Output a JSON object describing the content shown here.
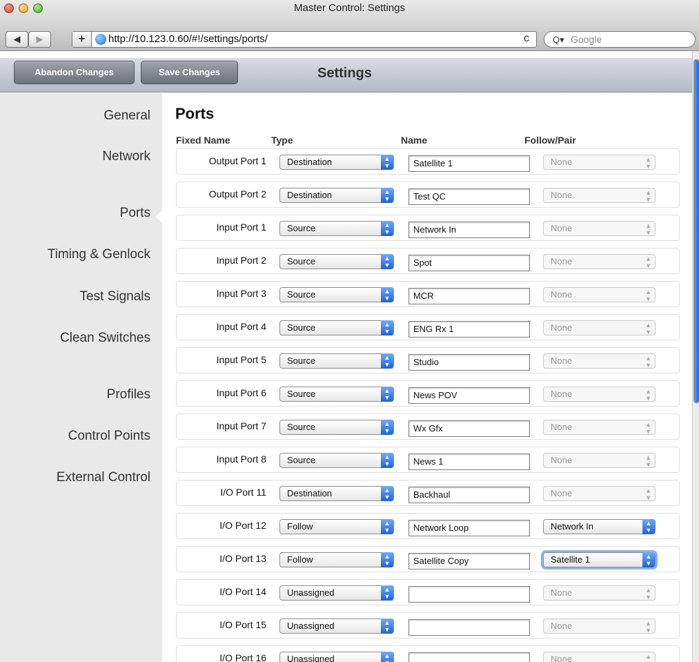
{
  "window": {
    "title": "Master Control: Settings"
  },
  "browser": {
    "url": "http://10.123.0.60/#!/settings/ports/",
    "search_placeholder": "Google",
    "back": "◀",
    "forward": "▶",
    "add": "+",
    "reload": "c"
  },
  "header": {
    "abandon_label": "Abandon Changes",
    "save_label": "Save Changes",
    "title": "Settings"
  },
  "sidebar": {
    "items": [
      {
        "label": "General"
      },
      {
        "label": "Network"
      },
      {
        "label": "Ports"
      },
      {
        "label": "Timing & Genlock"
      },
      {
        "label": "Test Signals"
      },
      {
        "label": "Clean Switches"
      },
      {
        "label": "Profiles"
      },
      {
        "label": "Control Points"
      },
      {
        "label": "External Control"
      }
    ],
    "active": "Ports"
  },
  "ports": {
    "heading": "Ports",
    "columns": {
      "fixed": "Fixed Name",
      "type": "Type",
      "name": "Name",
      "follow": "Follow/Pair"
    },
    "rows": [
      {
        "fixed": "Output Port 1",
        "type": "Destination",
        "name": "Satellite 1",
        "follow": "None",
        "follow_enabled": false
      },
      {
        "fixed": "Output Port 2",
        "type": "Destination",
        "name": "Test QC",
        "follow": "None",
        "follow_enabled": false
      },
      {
        "fixed": "Input Port 1",
        "type": "Source",
        "name": "Network In",
        "follow": "None",
        "follow_enabled": false
      },
      {
        "fixed": "Input Port 2",
        "type": "Source",
        "name": "Spot",
        "follow": "None",
        "follow_enabled": false
      },
      {
        "fixed": "Input Port 3",
        "type": "Source",
        "name": "MCR",
        "follow": "None",
        "follow_enabled": false
      },
      {
        "fixed": "Input Port 4",
        "type": "Source",
        "name": "ENG Rx 1",
        "follow": "None",
        "follow_enabled": false
      },
      {
        "fixed": "Input Port 5",
        "type": "Source",
        "name": "Studio",
        "follow": "None",
        "follow_enabled": false
      },
      {
        "fixed": "Input Port 6",
        "type": "Source",
        "name": "News POV",
        "follow": "None",
        "follow_enabled": false
      },
      {
        "fixed": "Input Port 7",
        "type": "Source",
        "name": "Wx Gfx",
        "follow": "None",
        "follow_enabled": false
      },
      {
        "fixed": "Input Port 8",
        "type": "Source",
        "name": "News 1",
        "follow": "None",
        "follow_enabled": false
      },
      {
        "fixed": "I/O Port 11",
        "type": "Destination",
        "name": "Backhaul",
        "follow": "None",
        "follow_enabled": false
      },
      {
        "fixed": "I/O Port 12",
        "type": "Follow",
        "name": "Network Loop",
        "follow": "Network In",
        "follow_enabled": true
      },
      {
        "fixed": "I/O Port 13",
        "type": "Follow",
        "name": "Satellite Copy",
        "follow": "Satellite 1",
        "follow_enabled": true,
        "focused": true
      },
      {
        "fixed": "I/O Port 14",
        "type": "Unassigned",
        "name": "",
        "follow": "None",
        "follow_enabled": false
      },
      {
        "fixed": "I/O Port 15",
        "type": "Unassigned",
        "name": "",
        "follow": "None",
        "follow_enabled": false
      },
      {
        "fixed": "I/O Port 16",
        "type": "Unassigned",
        "name": "",
        "follow": "None",
        "follow_enabled": false
      }
    ]
  },
  "colors": {
    "accent": "#2c66c7",
    "sidebar_bg": "#e9e9e9"
  }
}
